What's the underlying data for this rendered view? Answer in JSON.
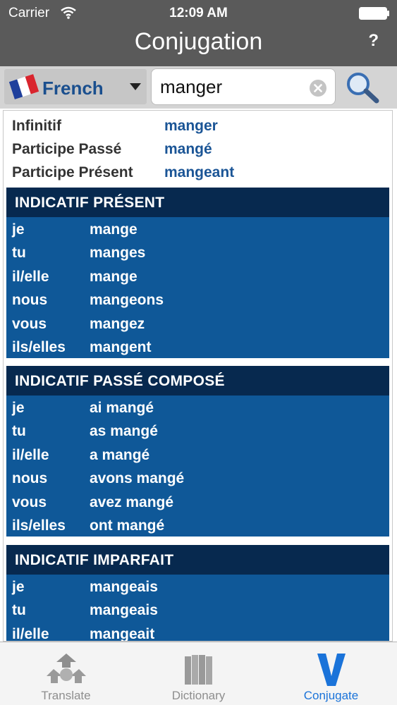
{
  "status": {
    "carrier": "Carrier",
    "time": "12:09 AM"
  },
  "nav": {
    "title": "Conjugation",
    "help_label": "?"
  },
  "search": {
    "language": "French",
    "value": "manger"
  },
  "infos": [
    {
      "label": "Infinitif",
      "value": "manger"
    },
    {
      "label": "Participe Passé",
      "value": "mangé"
    },
    {
      "label": "Participe Présent",
      "value": "mangeant"
    }
  ],
  "sections": [
    {
      "title": "INDICATIF PRÉSENT",
      "rows": [
        {
          "pronoun": "je",
          "form": "mange"
        },
        {
          "pronoun": "tu",
          "form": "manges"
        },
        {
          "pronoun": "il/elle",
          "form": "mange"
        },
        {
          "pronoun": "nous",
          "form": "mangeons"
        },
        {
          "pronoun": "vous",
          "form": "mangez"
        },
        {
          "pronoun": "ils/elles",
          "form": "mangent"
        }
      ]
    },
    {
      "title": "INDICATIF PASSÉ COMPOSÉ",
      "rows": [
        {
          "pronoun": "je",
          "form": "ai mangé"
        },
        {
          "pronoun": "tu",
          "form": "as mangé"
        },
        {
          "pronoun": "il/elle",
          "form": "a mangé"
        },
        {
          "pronoun": "nous",
          "form": "avons mangé"
        },
        {
          "pronoun": "vous",
          "form": "avez mangé"
        },
        {
          "pronoun": "ils/elles",
          "form": "ont mangé"
        }
      ]
    },
    {
      "title": "INDICATIF IMPARFAIT",
      "rows": [
        {
          "pronoun": "je",
          "form": "mangeais"
        },
        {
          "pronoun": "tu",
          "form": "mangeais"
        },
        {
          "pronoun": "il/elle",
          "form": "mangeait"
        }
      ]
    }
  ],
  "tabs": [
    {
      "label": "Translate",
      "icon": "translate-icon",
      "active": false
    },
    {
      "label": "Dictionary",
      "icon": "dictionary-icon",
      "active": false
    },
    {
      "label": "Conjugate",
      "icon": "conjugate-icon",
      "active": true
    }
  ],
  "colors": {
    "header_bg": "#5a5a5a",
    "section_header": "#07294f",
    "section_body": "#0f5898",
    "link_blue": "#1b5596",
    "tab_active": "#1a73d9"
  }
}
